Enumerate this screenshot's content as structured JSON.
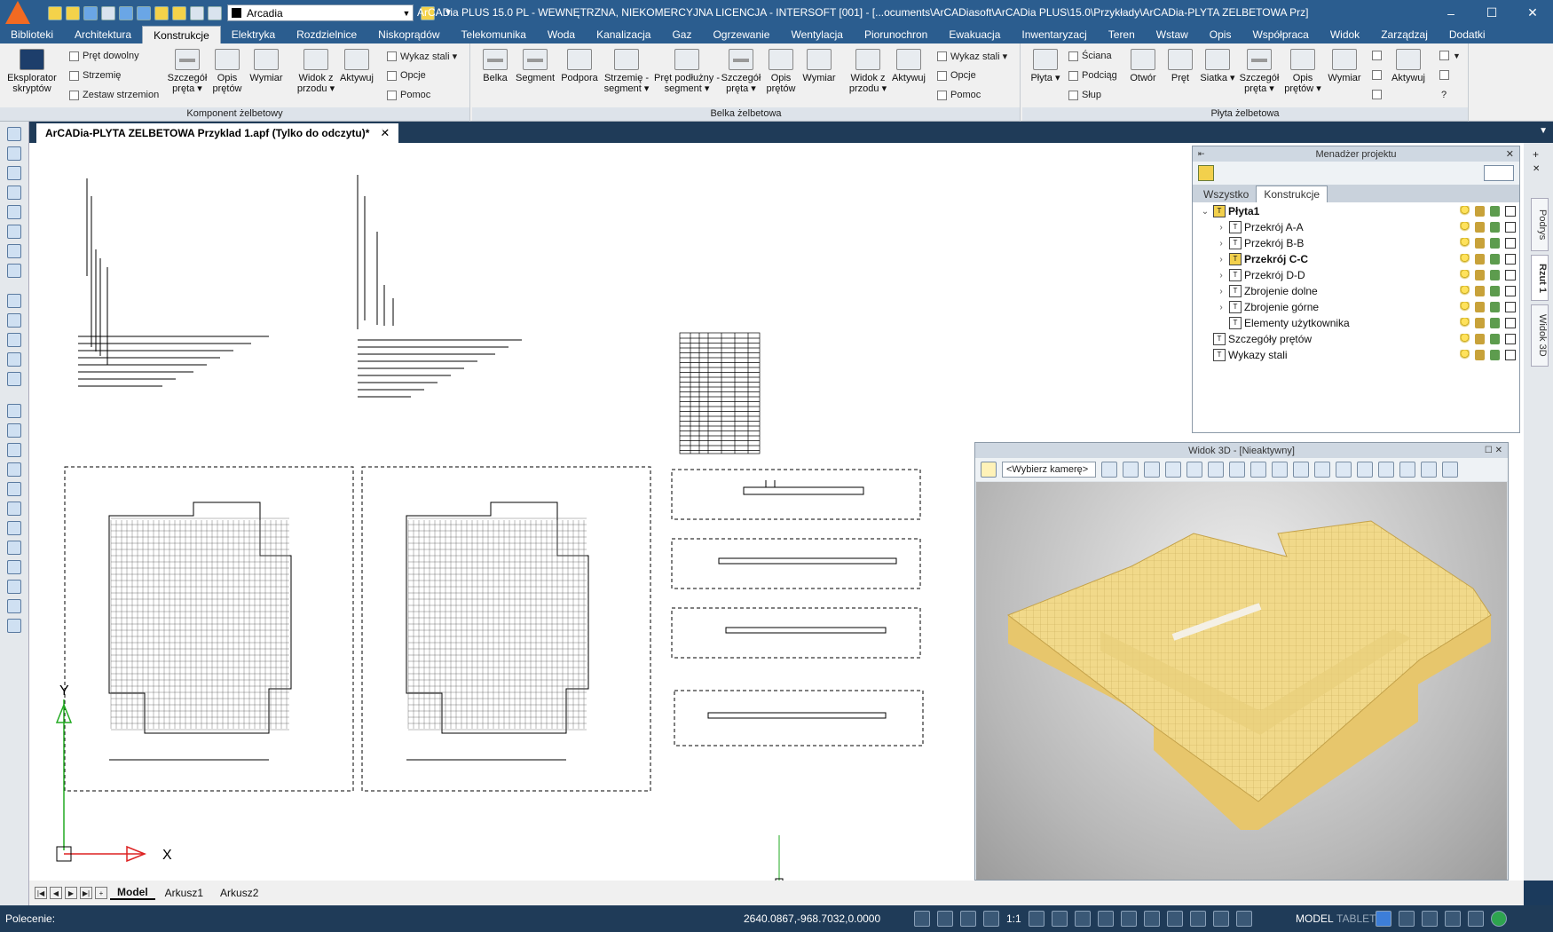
{
  "window": {
    "title": "ArCADia PLUS 15.0 PL - WEWNĘTRZNA, NIEKOMERCYJNA LICENCJA - INTERSOFT [001] - [...ocuments\\ArCADiasoft\\ArCADia PLUS\\15.0\\Przykłady\\ArCADia-PLYTA ZELBETOWA Prz]",
    "layer_combo": "Arcadia",
    "minimize": "–",
    "maximize": "☐",
    "close": "✕"
  },
  "menu": {
    "tabs": [
      "Biblioteki",
      "Architektura",
      "Konstrukcje",
      "Elektryka",
      "Rozdzielnice",
      "Niskoprądów",
      "Telekomunika",
      "Woda",
      "Kanalizacja",
      "Gaz",
      "Ogrzewanie",
      "Wentylacja",
      "Piorunochron",
      "Ewakuacja",
      "Inwentaryzacj",
      "Teren",
      "Wstaw",
      "Opis",
      "Współpraca",
      "Widok",
      "Zarządzaj",
      "Dodatki"
    ],
    "active": "Konstrukcje"
  },
  "ribbon": {
    "group1": {
      "title": "Komponent żelbetowy",
      "eksplorator": "Eksplorator skryptów",
      "pret_dowolny": "Pręt dowolny",
      "strzemie": "Strzemię",
      "zestaw": "Zestaw strzemion",
      "szczegol": "Szczegół pręta ▾",
      "opis": "Opis prętów",
      "wymiar": "Wymiar",
      "widok": "Widok z przodu ▾",
      "aktywuj": "Aktywuj",
      "wykaz": "Wykaz stali ▾",
      "opcje": "Opcje",
      "pomoc": "Pomoc"
    },
    "group2": {
      "title": "Belka żelbetowa",
      "belka": "Belka",
      "segment": "Segment",
      "podpora": "Podpora",
      "strzemie": "Strzemię - segment ▾",
      "pret": "Pręt podłużny - segment ▾",
      "szczegol": "Szczegół pręta ▾",
      "opis": "Opis prętów",
      "wymiar": "Wymiar",
      "widok": "Widok z przodu ▾",
      "aktywuj": "Aktywuj",
      "wykaz": "Wykaz stali ▾",
      "opcje": "Opcje",
      "pomoc": "Pomoc"
    },
    "group3": {
      "title": "Płyta żelbetowa",
      "plyta": "Płyta ▾",
      "sciana": "Ściana",
      "podciag": "Podciąg",
      "slup": "Słup",
      "otwor": "Otwór",
      "pret": "Pręt",
      "siatka": "Siatka ▾",
      "szczegol": "Szczegół pręta ▾",
      "opis": "Opis prętów ▾",
      "wymiar": "Wymiar",
      "aktywuj": "Aktywuj",
      "help": "?"
    }
  },
  "document": {
    "tab": "ArCADia-PLYTA ZELBETOWA Przyklad 1.apf (Tylko do odczytu)*",
    "close": "✕",
    "add": "+",
    "axis_x": "X",
    "axis_y": "Y"
  },
  "project_manager": {
    "title": "Menadżer projektu",
    "tabs": [
      "Wszystko",
      "Konstrukcje"
    ],
    "active_tab": "Konstrukcje",
    "items": [
      {
        "label": "Płyta1",
        "level": 0,
        "bold": true,
        "expanded": true
      },
      {
        "label": "Przekrój A-A",
        "level": 1,
        "bold": false
      },
      {
        "label": "Przekrój B-B",
        "level": 1,
        "bold": false
      },
      {
        "label": "Przekrój C-C",
        "level": 1,
        "bold": true
      },
      {
        "label": "Przekrój D-D",
        "level": 1,
        "bold": false
      },
      {
        "label": "Zbrojenie dolne",
        "level": 1,
        "bold": false
      },
      {
        "label": "Zbrojenie górne",
        "level": 1,
        "bold": false
      },
      {
        "label": "Elementy użytkownika",
        "level": 1,
        "bold": false
      },
      {
        "label": "Szczegóły prętów",
        "level": 0,
        "bold": false
      },
      {
        "label": "Wykazy stali",
        "level": 0,
        "bold": false
      }
    ]
  },
  "view3d": {
    "title": "Widok 3D - [Nieaktywny]",
    "camera": "<Wybierz kamerę>"
  },
  "side_tabs": [
    "Podrys",
    "Rzut 1",
    "Widok 3D"
  ],
  "layout_tabs": [
    "Model",
    "Arkusz1",
    "Arkusz2"
  ],
  "status": {
    "command_label": "Polecenie:",
    "coords": "2640.0867,-968.7032,0.0000",
    "scale": "1:1",
    "model": "MODEL",
    "tablet": "TABLET"
  }
}
